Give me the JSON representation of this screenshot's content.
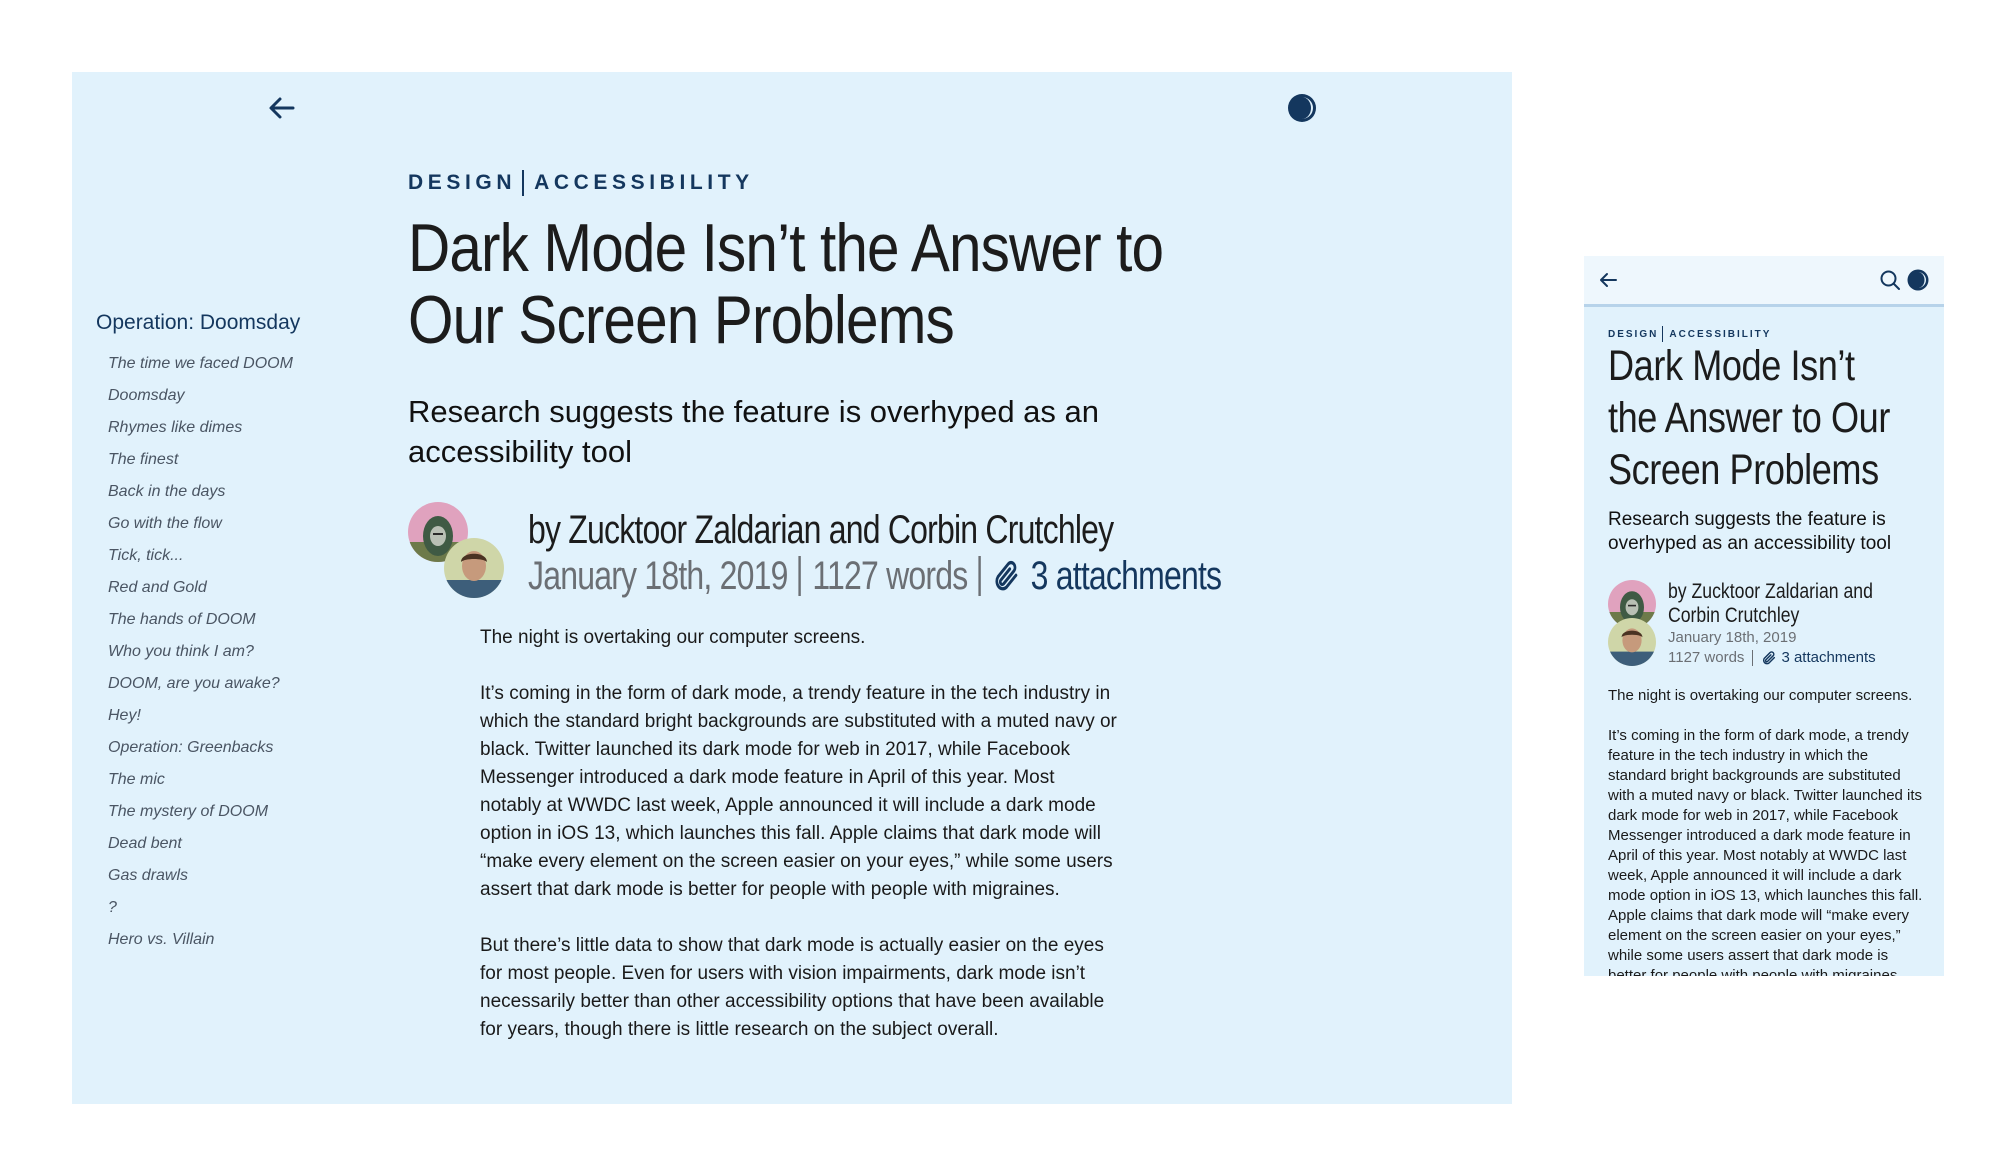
{
  "article": {
    "categories": [
      "DESIGN",
      "ACCESSIBILITY"
    ],
    "title": "Dark Mode Isn’t the Answer to Our Screen Problems",
    "subtitle": "Research suggests the feature is overhyped as an accessibility tool",
    "byline": "by Zucktoor Zaldarian and Corbin Crutchley",
    "date": "January 18th, 2019",
    "word_count": "1127 words",
    "attachments": "3 attachments",
    "paragraphs": [
      "The night is overtaking our computer screens.",
      "It’s coming in the form of dark mode, a trendy feature in the tech industry in which the standard bright backgrounds are substituted with a muted navy or black. Twitter launched its dark mode for web in 2017, while Facebook Messenger introduced a dark mode feature in April of this year. Most notably at WWDC last week, Apple announced it will include a dark mode option in iOS 13, which launches this fall. Apple claims that dark mode will “make every element on the screen easier on your eyes,” while some users assert that dark mode is better for people with people with migraines.",
      "But there’s little data to show that dark mode is actually easier on the eyes for most people. Even for users with vision impairments, dark mode isn’t necessarily better than other accessibility options that have been available for years, though there is little research on the subject overall."
    ]
  },
  "toc": {
    "title": "Operation: Doomsday",
    "items": [
      "The time we faced DOOM",
      "Doomsday",
      "Rhymes like dimes",
      "The finest",
      "Back in the days",
      "Go with the flow",
      "Tick, tick...",
      "Red and Gold",
      "The hands of DOOM",
      "Who you think I am?",
      "DOOM, are you awake?",
      "Hey!",
      "Operation: Greenbacks",
      "The mic",
      "The mystery of DOOM",
      "Dead bent",
      "Gas drawls",
      "?",
      "Hero vs. Villain"
    ]
  },
  "icons": {
    "back": "arrow-left-icon",
    "theme": "half-moon-theme-icon",
    "search": "search-icon",
    "attachment": "paperclip-icon"
  },
  "colors": {
    "background": "#e1f2fc",
    "accent": "#14375e",
    "muted": "#6b6f74"
  }
}
